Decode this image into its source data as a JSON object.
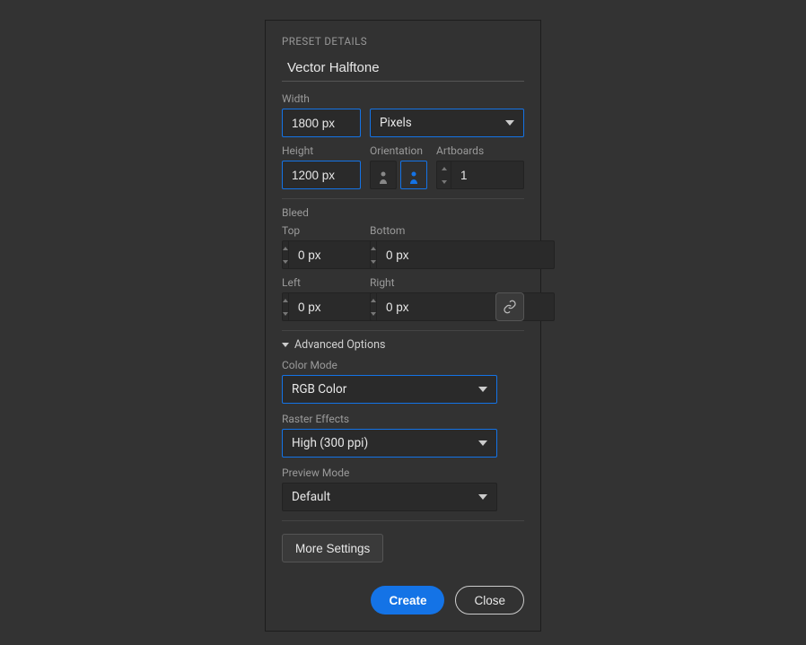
{
  "header": {
    "title": "PRESET DETAILS"
  },
  "name": "Vector Halftone",
  "labels": {
    "width": "Width",
    "height": "Height",
    "orientation": "Orientation",
    "artboards": "Artboards",
    "bleed": "Bleed",
    "top": "Top",
    "bottom": "Bottom",
    "left": "Left",
    "right": "Right",
    "advanced": "Advanced Options",
    "colorMode": "Color Mode",
    "rasterEffects": "Raster Effects",
    "previewMode": "Preview Mode"
  },
  "values": {
    "width": "1800 px",
    "units": "Pixels",
    "height": "1200 px",
    "artboards": "1",
    "bleedTop": "0 px",
    "bleedBottom": "0 px",
    "bleedLeft": "0 px",
    "bleedRight": "0 px",
    "colorMode": "RGB Color",
    "rasterEffects": "High (300 ppi)",
    "previewMode": "Default"
  },
  "buttons": {
    "more": "More Settings",
    "create": "Create",
    "close": "Close"
  }
}
